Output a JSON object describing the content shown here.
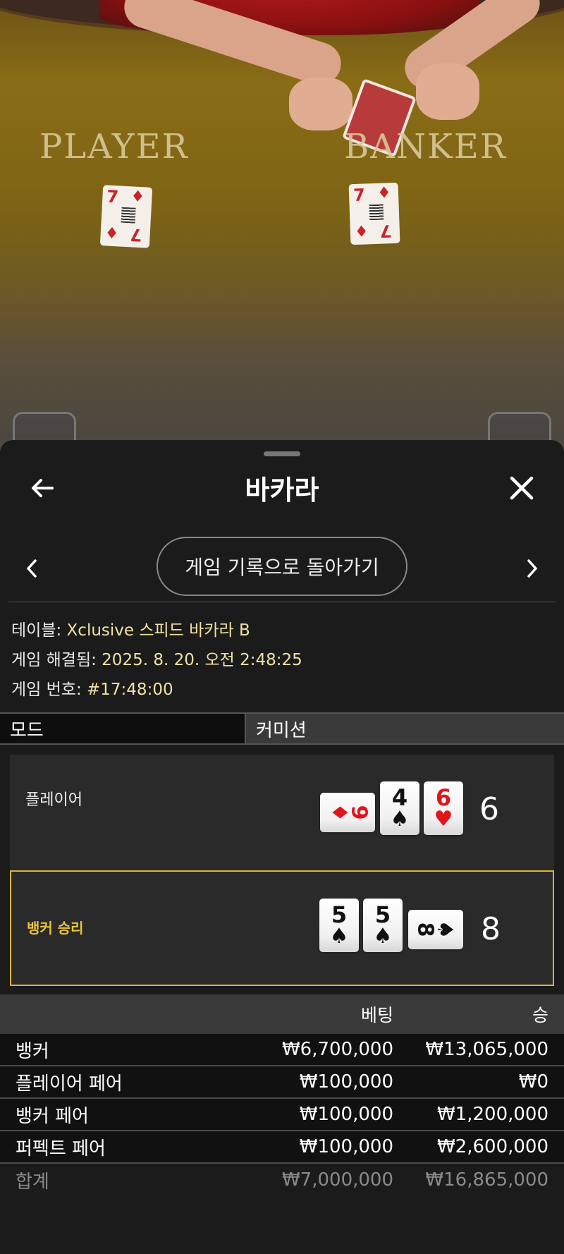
{
  "video": {
    "felt_labels": {
      "player": "PLAYER",
      "banker": "BANKER"
    },
    "table_cards": [
      {
        "rank": "7",
        "suit": "♦"
      },
      {
        "rank": "7",
        "suit": "♦"
      }
    ]
  },
  "sheet": {
    "title": "바카라",
    "back_icon": "arrow-left-icon",
    "close_icon": "close-icon",
    "back_to_history_label": "게임 기록으로 돌아가기"
  },
  "info": {
    "table_label": "테이블: ",
    "table_value": "Xclusive 스피드 바카라 B",
    "resolved_label": "게임 해결됨: ",
    "resolved_value": "2025. 8. 20. 오전 2:48:25",
    "game_no_label": "게임 번호: ",
    "game_no_value": "#17:48:00"
  },
  "mode": {
    "key": "모드",
    "value": "커미션"
  },
  "hands": {
    "player": {
      "label": "플레이어",
      "score": "6",
      "cards": [
        {
          "rank": "9",
          "suit": "♦",
          "color": "#e0151b",
          "orientation": "sideways"
        },
        {
          "rank": "4",
          "suit": "♠",
          "color": "#111111",
          "orientation": "upright"
        },
        {
          "rank": "6",
          "suit": "♥",
          "color": "#e0151b",
          "orientation": "upright"
        }
      ]
    },
    "banker": {
      "label": "뱅커 승리",
      "score": "8",
      "cards": [
        {
          "rank": "5",
          "suit": "♠",
          "color": "#111111",
          "orientation": "upright"
        },
        {
          "rank": "5",
          "suit": "♠",
          "color": "#111111",
          "orientation": "upright"
        },
        {
          "rank": "8",
          "suit": "♠",
          "color": "#111111",
          "orientation": "sideways"
        }
      ]
    }
  },
  "bets": {
    "headers": {
      "bet": "베팅",
      "win": "승"
    },
    "rows": [
      {
        "name": "뱅커",
        "bet": "₩6,700,000",
        "win": "₩13,065,000"
      },
      {
        "name": "플레이어 페어",
        "bet": "₩100,000",
        "win": "₩0"
      },
      {
        "name": "뱅커 페어",
        "bet": "₩100,000",
        "win": "₩1,200,000"
      },
      {
        "name": "퍼펙트 페어",
        "bet": "₩100,000",
        "win": "₩2,600,000"
      }
    ],
    "total": {
      "name": "합계",
      "bet": "₩7,000,000",
      "win": "₩16,865,000"
    }
  },
  "colors": {
    "accent_gold": "#e8c33a",
    "info_value": "#f1e1a6",
    "sheet_bg": "#1b1b1b"
  }
}
